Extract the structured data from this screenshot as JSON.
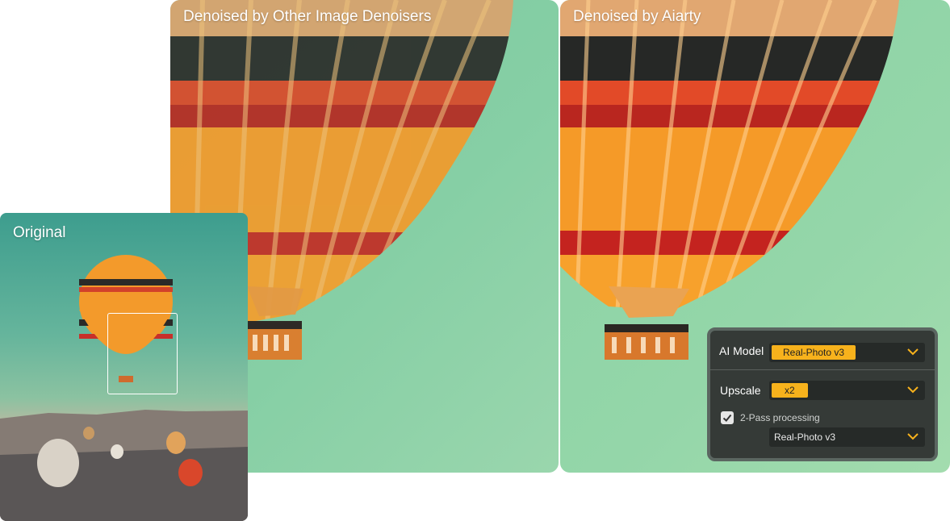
{
  "panels": {
    "other": {
      "title": "Denoised by Other Image Denoisers"
    },
    "aiarty": {
      "title": "Denoised by Aiarty"
    },
    "original": {
      "title": "Original"
    }
  },
  "settings": {
    "ai_model": {
      "label": "AI Model",
      "value": "Real-Photo v3"
    },
    "upscale": {
      "label": "Upscale",
      "value": "x2"
    },
    "two_pass": {
      "label": "2-Pass processing",
      "checked": true,
      "model": "Real-Photo v3"
    }
  },
  "icons": {
    "dropdown": "chevron-down-icon",
    "checkbox": "checkmark-icon"
  },
  "colors": {
    "accent": "#f7b21c",
    "panel_bg": "#353a37"
  }
}
